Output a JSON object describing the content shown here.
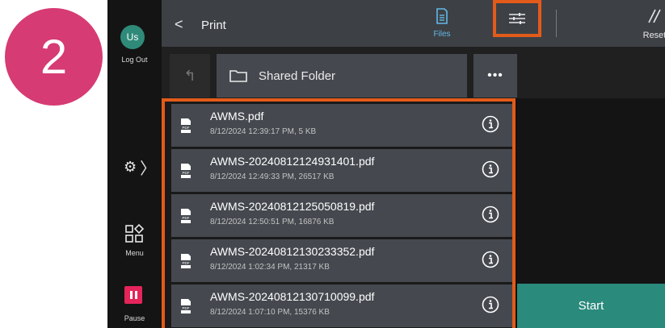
{
  "step_number": "2",
  "sidebar": {
    "avatar_initials": "Us",
    "logout_label": "Log Out",
    "menu_label": "Menu",
    "pause_label": "Pause"
  },
  "topbar": {
    "back_icon": "chevron-left-icon",
    "title": "Print",
    "files_label": "Files",
    "reset_label": "Reset"
  },
  "folder": {
    "name": "Shared Folder",
    "more_label": "•••"
  },
  "files": [
    {
      "name": "AWMS.pdf",
      "meta": "8/12/2024 12:39:17 PM, 5 KB"
    },
    {
      "name": "AWMS-20240812124931401.pdf",
      "meta": "8/12/2024 12:49:33 PM, 26517 KB"
    },
    {
      "name": "AWMS-20240812125050819.pdf",
      "meta": "8/12/2024 12:50:51 PM, 16876 KB"
    },
    {
      "name": "AWMS-20240812130233352.pdf",
      "meta": "8/12/2024 1:02:34 PM, 21317 KB"
    },
    {
      "name": "AWMS-20240812130710099.pdf",
      "meta": "8/12/2024 1:07:10 PM, 15376 KB"
    }
  ],
  "start_label": "Start",
  "colors": {
    "step_circle": "#d63b73",
    "highlight": "#e35b1a",
    "accent_blue": "#63b8e8",
    "start": "#2a8a7c",
    "pause": "#e5245a"
  }
}
